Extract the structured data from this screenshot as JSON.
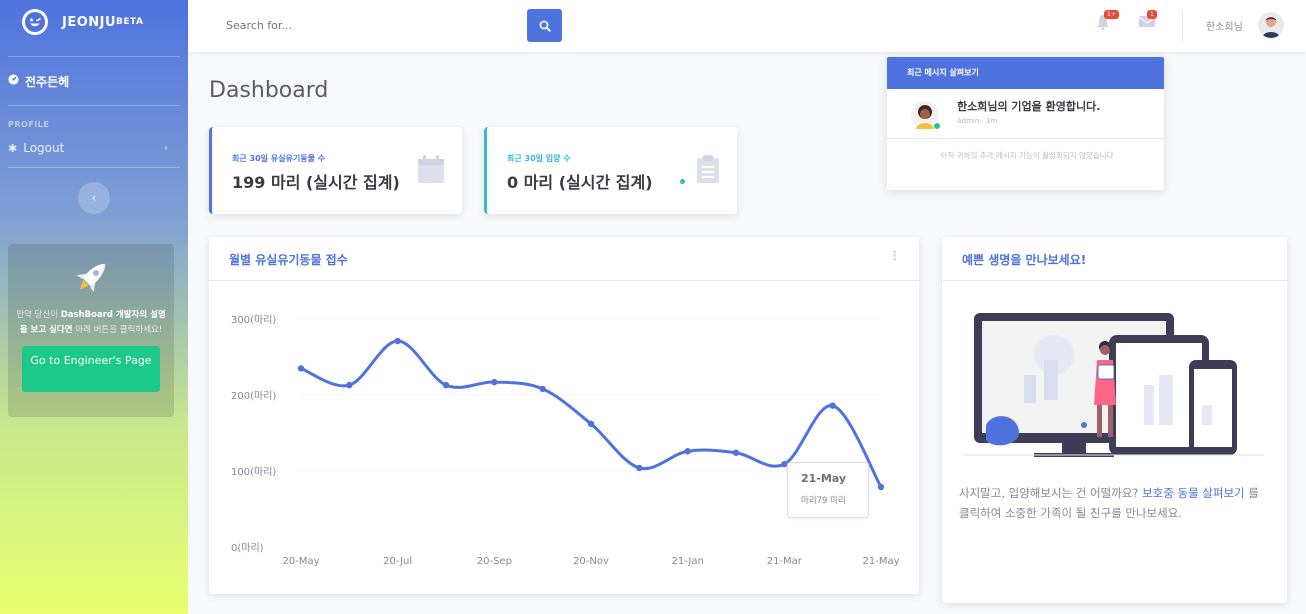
{
  "brand": {
    "name": "JEONJU",
    "sup": "BETA"
  },
  "sidebar": {
    "nav_dashboard": "전주든헤",
    "heading_profile": "PROFILE",
    "logout": "Logout",
    "toggle_icon": "chevron-left-icon",
    "promo": {
      "text_before": "만약 당신이 ",
      "text_bold": "DashBoard 개발자의 설명을 보고 싶다면",
      "text_after": " 아래 버튼을 클릭하세요!",
      "button": "Go to Engineer's Page"
    }
  },
  "topbar": {
    "search_placeholder": "Search for...",
    "alerts_badge": "1+",
    "messages_badge": "1",
    "user_name": "한소희님"
  },
  "page_title": "Dashboard",
  "stats": [
    {
      "label": "최근 30일 유실유기동물 수",
      "value": "199 마리 (실시간 집계)",
      "color": "#4e73df",
      "icon": "calendar-icon"
    },
    {
      "label": "최근 30일 입양 수",
      "value": "0 마리 (실시간 집계)",
      "color": "#36b9cc",
      "icon": "clipboard-icon"
    }
  ],
  "messages": {
    "header": "최근 메시지 살펴보기",
    "item_title": "한소희님의 기업을 환영합니다.",
    "item_meta": "Admin · 1m",
    "footer": "아직 귀하의 추가 메시지 기능이 활성화되지 않았습니다"
  },
  "chart_card": {
    "title": "월별 유실유기동물 접수"
  },
  "chart_data": {
    "type": "line",
    "title": "월별 유실유기동물 접수",
    "x_ticks": [
      "20-May",
      "20-Jul",
      "20-Sep",
      "20-Nov",
      "21-Jan",
      "21-Mar",
      "21-May"
    ],
    "y_ticks": [
      "0(마리)",
      "100(마리)",
      "200(마리)",
      "300(마리)"
    ],
    "ylim": [
      0,
      300
    ],
    "x": [
      "20-May",
      "20-Jun",
      "20-Jul",
      "20-Aug",
      "20-Sep",
      "20-Oct",
      "20-Nov",
      "20-Dec",
      "21-Jan",
      "21-Feb",
      "21-Mar",
      "21-Apr",
      "21-May"
    ],
    "values": [
      235,
      213,
      271,
      213,
      217,
      208,
      162,
      104,
      126,
      124,
      109,
      186,
      79
    ],
    "color": "#4e73df",
    "grid": true
  },
  "tooltip": {
    "title": "21-May",
    "body": "마리79 마리"
  },
  "adopt_card": {
    "title": "예쁜 생명을 만나보세요!",
    "text_before": "사지말고, 입양해보시는 건 어떨까요? ",
    "link": "보호중 동물 살펴보기",
    "text_after": " 를 클릭하여 소중한 가족이 될 친구를 만나보세요."
  }
}
